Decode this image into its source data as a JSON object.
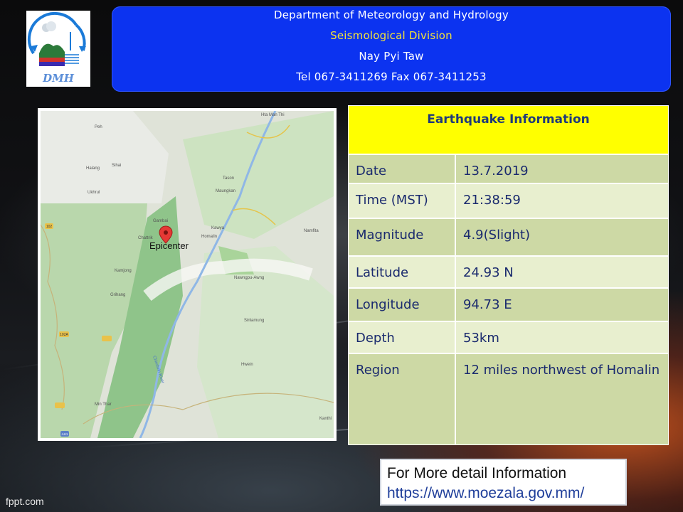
{
  "header": {
    "line1": "Department of Meteorology and Hydrology",
    "line2": "Seismological Division",
    "line3": "Nay Pyi Taw",
    "line4": "Tel 067-3411269 Fax 067-3411253"
  },
  "logo": {
    "text": "DMH",
    "icon": "dmh-logo"
  },
  "map": {
    "marker_label": "Epicenter",
    "place_labels": [
      "Peh",
      "Halang",
      "Sihai",
      "Ukhrul",
      "Gambai",
      "Chattrik",
      "Kamjong",
      "Grihang",
      "Tason",
      "Maungkan",
      "Kawya",
      "Homalin",
      "Namfita",
      "Nawngpu-Awng",
      "Sinlamung",
      "Hwein",
      "Min Thar",
      "Kanthi",
      "Hta Man Thi",
      "Chindwin River",
      "102",
      "102A",
      "AH1"
    ]
  },
  "info": {
    "title": "Earthquake Information",
    "rows": [
      {
        "key": "Date",
        "value": "13.7.2019"
      },
      {
        "key": "Time (MST)",
        "value": "21:38:59"
      },
      {
        "key": "Magnitude",
        "value": "4.9(Slight)"
      },
      {
        "key": "Latitude",
        "value": "24.93 N"
      },
      {
        "key": "Longitude",
        "value": "94.73 E"
      },
      {
        "key": "Depth",
        "value": "53km"
      },
      {
        "key": "Region",
        "value": "12 miles northwest of Homalin"
      }
    ]
  },
  "more": {
    "line1": "For More detail Information",
    "line2": "https://www.moezala.gov.mm/"
  },
  "watermark": "fppt.com",
  "colors": {
    "header_bg": "#0c33f0",
    "title_bg": "#ffff00",
    "row_dark": "#cdd9a5",
    "row_light": "#e8efcf",
    "text_blue": "#1a2a6e"
  }
}
